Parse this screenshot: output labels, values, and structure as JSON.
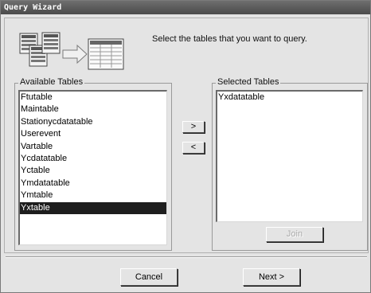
{
  "window": {
    "title": "Query Wizard"
  },
  "instruction": "Select the tables that you want to query.",
  "available": {
    "label": "Available Tables",
    "items": [
      "Ftutable",
      "Maintable",
      "Stationycdatatable",
      "Userevent",
      "Vartable",
      "Ycdatatable",
      "Yctable",
      "Ymdatatable",
      "Ymtable",
      "Yxtable"
    ],
    "selected_item": "Yxtable"
  },
  "selected": {
    "label": "Selected Tables",
    "items": [
      "Yxdatatable"
    ]
  },
  "buttons": {
    "add": ">",
    "remove": "<",
    "join": "Join",
    "cancel": "Cancel",
    "next": "Next >"
  },
  "icons": {
    "wizard_graphic": "tables-to-query-icon"
  }
}
